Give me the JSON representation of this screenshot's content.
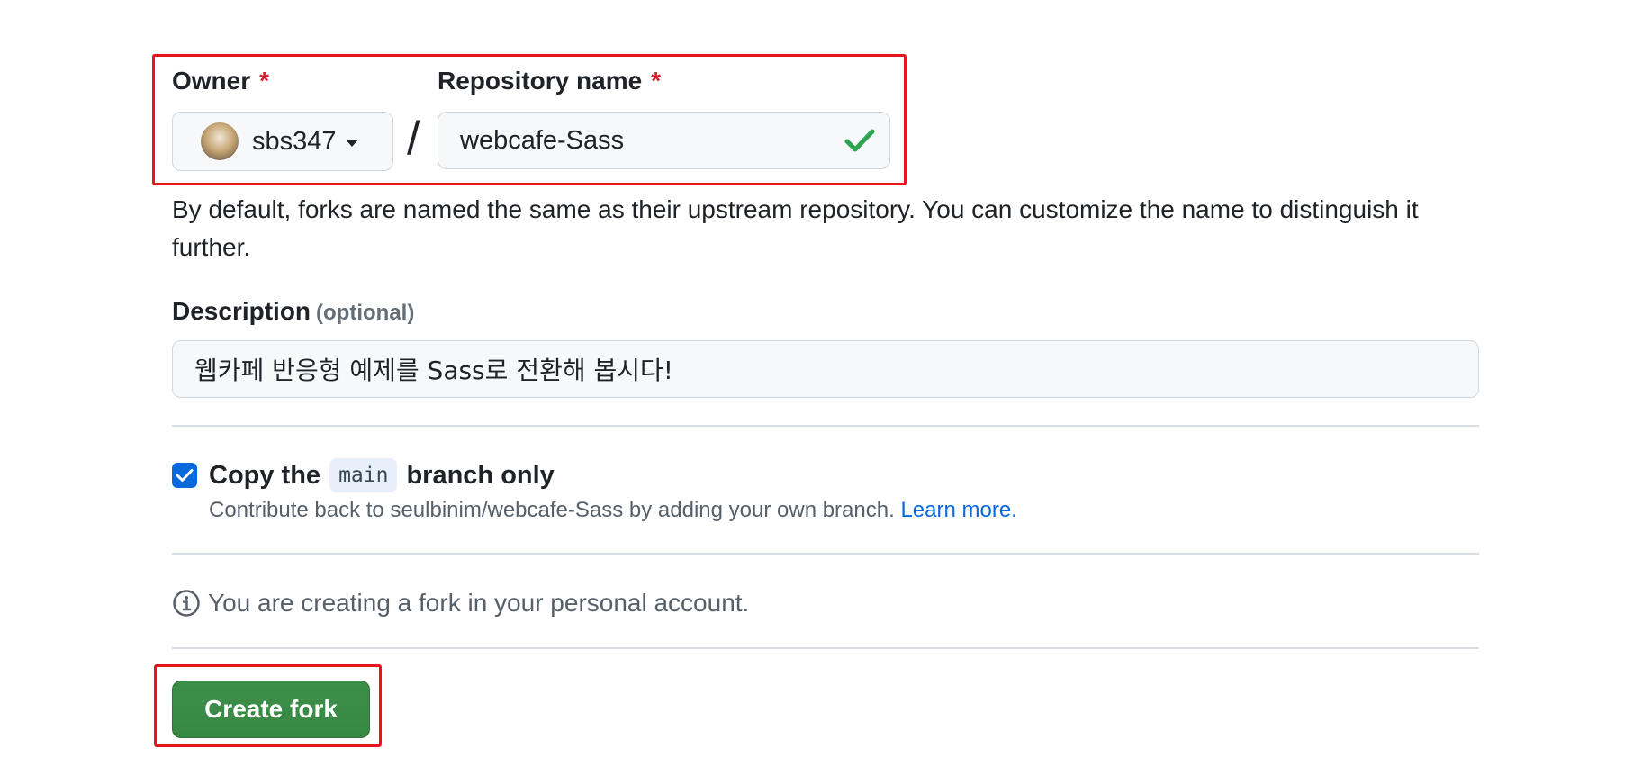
{
  "owner": {
    "label": "Owner",
    "required_mark": "*",
    "value": "sbs347"
  },
  "repository": {
    "label": "Repository name",
    "required_mark": "*",
    "value": "webcafe-Sass",
    "separator": "/"
  },
  "hint_text": "By default, forks are named the same as their upstream repository. You can customize the name to distinguish it further.",
  "description": {
    "label": "Description",
    "optional": "(optional)",
    "value": "웹카페 반응형 예제를 Sass로 전환해 봅시다!"
  },
  "copy_branch": {
    "checked": true,
    "prefix": "Copy the",
    "branch": "main",
    "suffix": "branch only",
    "sub_text": "Contribute back to seulbinim/webcafe-Sass by adding your own branch.",
    "learn_more": "Learn more."
  },
  "info_text": "You are creating a fork in your personal account.",
  "create_button": "Create fork",
  "colors": {
    "highlight": "#e5141e",
    "primary_button": "#378842",
    "link": "#0969da",
    "check": "#2da44e",
    "required": "#cf222e"
  }
}
